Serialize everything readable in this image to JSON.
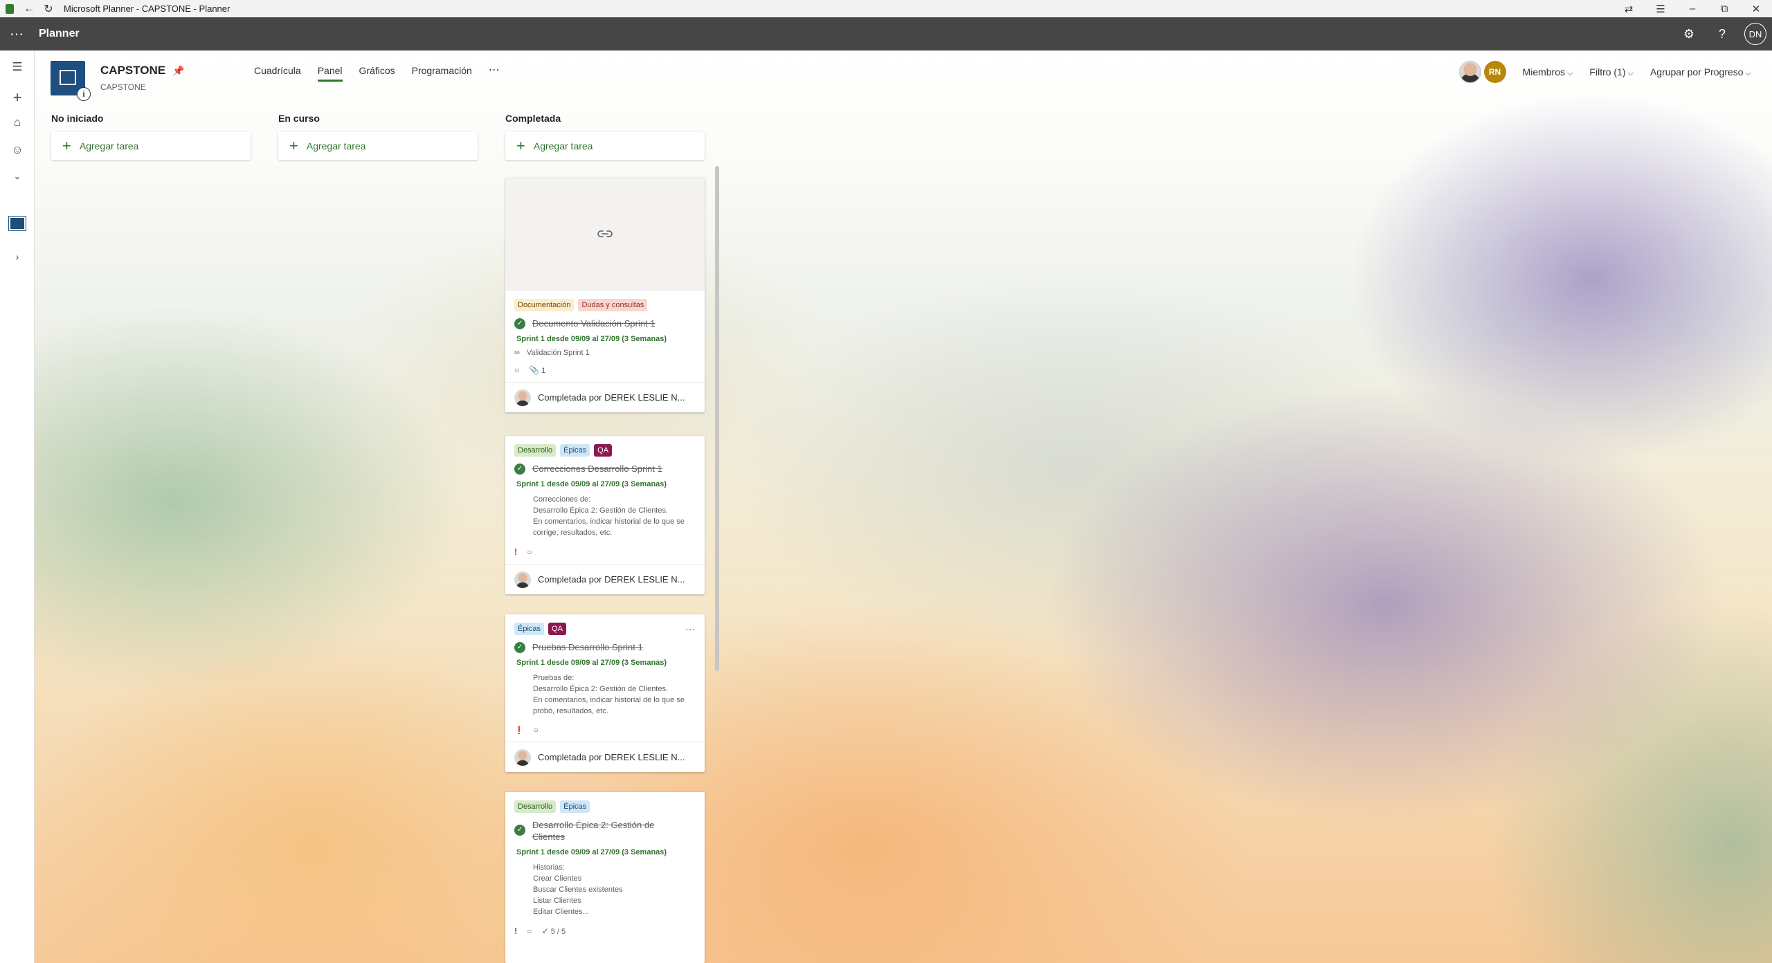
{
  "window": {
    "title": "Microsoft Planner - CAPSTONE - Planner"
  },
  "suite": {
    "app_name": "Planner",
    "user_initials": "DN"
  },
  "left_rail": {
    "icons": [
      "hamburger-icon",
      "add-icon",
      "home-icon",
      "person-icon",
      "chevron-down-icon",
      "plan-icon",
      "chevron-right-icon"
    ]
  },
  "plan": {
    "name": "CAPSTONE",
    "group": "CAPSTONE",
    "info_glyph": "i"
  },
  "tabs": [
    {
      "label": "Cuadrícula",
      "active": false
    },
    {
      "label": "Panel",
      "active": true
    },
    {
      "label": "Gráficos",
      "active": false
    },
    {
      "label": "Programación",
      "active": false
    }
  ],
  "header_right": {
    "member_initials": "RN",
    "members_label": "Miembros",
    "filter_label": "Filtro (1)",
    "group_by_label": "Agrupar por Progreso"
  },
  "buckets": [
    {
      "title": "No iniciado",
      "add_label": "Agregar tarea"
    },
    {
      "title": "En curso",
      "add_label": "Agregar tarea"
    },
    {
      "title": "Completada",
      "add_label": "Agregar tarea"
    }
  ],
  "cards": [
    {
      "labels": [
        "Documentación",
        "Dudas y consultas"
      ],
      "title": "Documento Validación Sprint 1",
      "dates": "Sprint 1 desde 09/09 al 27/09 (3 Semanas)",
      "link": "Validación Sprint 1",
      "attachments": "1",
      "completed_by": "Completada por DEREK LESLIE N..."
    },
    {
      "labels": [
        "Desarrollo",
        "Épicas",
        "QA"
      ],
      "title": "Correcciones Desarrollo Sprint 1",
      "dates": "Sprint 1 desde 09/09 al 27/09 (3 Semanas)",
      "description": "Correcciones de:\nDesarrollo Épica 2: Gestión de Clientes.\nEn comentarios, indicar historial de lo que se corrige, resultados, etc.",
      "priority": "!",
      "completed_by": "Completada por DEREK LESLIE N..."
    },
    {
      "labels": [
        "Épicas",
        "QA"
      ],
      "title": "Pruebas Desarrollo Sprint 1",
      "dates": "Sprint 1 desde 09/09 al 27/09 (3 Semanas)",
      "description": "Pruebas de:\nDesarrollo Épica 2: Gestión de Clientes.\nEn comentarios, indicar historial de lo que se probó, resultados, etc.",
      "completed_by": "Completada por DEREK LESLIE N..."
    },
    {
      "labels": [
        "Desarrollo",
        "Épicas"
      ],
      "title": "Desarrollo Épica 2: Gestión de Clientes",
      "dates": "Sprint 1 desde 09/09 al 27/09 (3 Semanas)",
      "description": "Historias:\nCrear Clientes\nBuscar Clientes existentes\nListar Clientes\nEditar Clientes...",
      "priority": "!",
      "checklist": "5 / 5"
    }
  ],
  "colors": {
    "accent": "#31752f",
    "suite_bar": "#464646",
    "qa_label": "#8b1850",
    "urgent": "#c4314b"
  }
}
